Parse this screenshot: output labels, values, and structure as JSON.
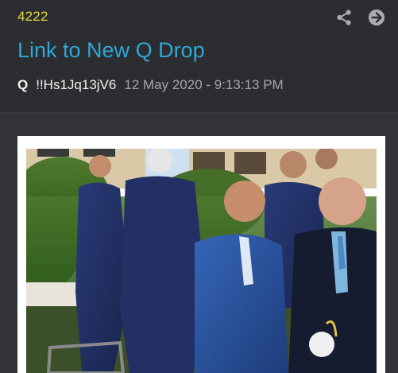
{
  "post": {
    "number": "4222",
    "title": "Link to New Q Drop",
    "author": "Q",
    "tripcode": "!!Hs1Jq13jV6",
    "timestamp": "12 May 2020 - 9:13:13 PM"
  },
  "icons": {
    "share": "share-icon",
    "next": "arrow-right-circle-icon"
  },
  "colors": {
    "background": "#2c2d30",
    "number": "#e8d544",
    "title_link": "#2ea7d6",
    "timestamp": "#a3a5a8",
    "author": "#f2f2f2"
  }
}
